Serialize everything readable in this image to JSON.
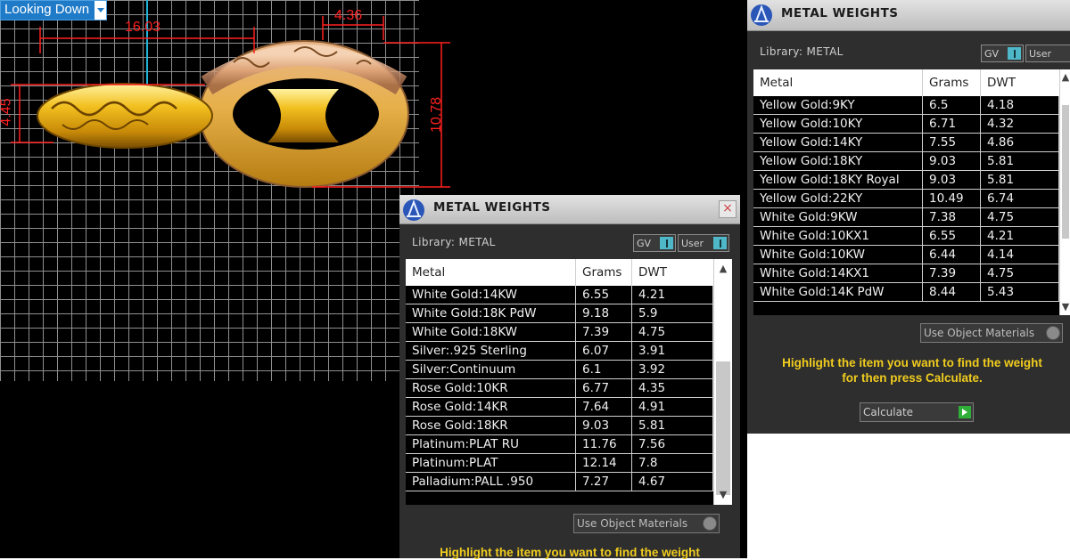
{
  "viewport": {
    "view_label": "Looking Down",
    "dimensions": [
      "16.03",
      "4.36",
      "4.45",
      "10.78"
    ]
  },
  "panel_front": {
    "title": "METAL WEIGHTS",
    "library_label": "Library: METAL",
    "toggle_gv": "GV",
    "toggle_user": "User",
    "columns": [
      "Metal",
      "Grams",
      "DWT"
    ],
    "rows": [
      [
        "White Gold:14KW",
        "6.55",
        "4.21"
      ],
      [
        "White Gold:18K PdW",
        "9.18",
        "5.9"
      ],
      [
        "White Gold:18KW",
        "7.39",
        "4.75"
      ],
      [
        "Silver:.925 Sterling",
        "6.07",
        "3.91"
      ],
      [
        "Silver:Continuum",
        "6.1",
        "3.92"
      ],
      [
        "Rose Gold:10KR",
        "6.77",
        "4.35"
      ],
      [
        "Rose Gold:14KR",
        "7.64",
        "4.91"
      ],
      [
        "Rose Gold:18KR",
        "9.03",
        "5.81"
      ],
      [
        "Platinum:PLAT RU",
        "11.76",
        "7.56"
      ],
      [
        "Platinum:PLAT",
        "12.14",
        "7.8"
      ],
      [
        "Palladium:PALL .950",
        "7.27",
        "4.67"
      ]
    ],
    "use_object_materials": "Use Object Materials",
    "hint": "Highlight the item you want to find the weight"
  },
  "panel_back": {
    "title": "METAL WEIGHTS",
    "library_label": "Library: METAL",
    "toggle_gv": "GV",
    "toggle_user": "User",
    "columns": [
      "Metal",
      "Grams",
      "DWT"
    ],
    "rows": [
      [
        "Yellow Gold:9KY",
        "6.5",
        "4.18"
      ],
      [
        "Yellow Gold:10KY",
        "6.71",
        "4.32"
      ],
      [
        "Yellow Gold:14KY",
        "7.55",
        "4.86"
      ],
      [
        "Yellow Gold:18KY",
        "9.03",
        "5.81"
      ],
      [
        "Yellow Gold:18KY Royal",
        "9.03",
        "5.81"
      ],
      [
        "Yellow Gold:22KY",
        "10.49",
        "6.74"
      ],
      [
        "White Gold:9KW",
        "7.38",
        "4.75"
      ],
      [
        "White Gold:10KX1",
        "6.55",
        "4.21"
      ],
      [
        "White Gold:10KW",
        "6.44",
        "4.14"
      ],
      [
        "White Gold:14KX1",
        "7.39",
        "4.75"
      ],
      [
        "White Gold:14K PdW",
        "8.44",
        "5.43"
      ]
    ],
    "use_object_materials": "Use Object Materials",
    "hint_line1": "Highlight the item you want to find the weight",
    "hint_line2": "for then press Calculate.",
    "calculate": "Calculate"
  }
}
